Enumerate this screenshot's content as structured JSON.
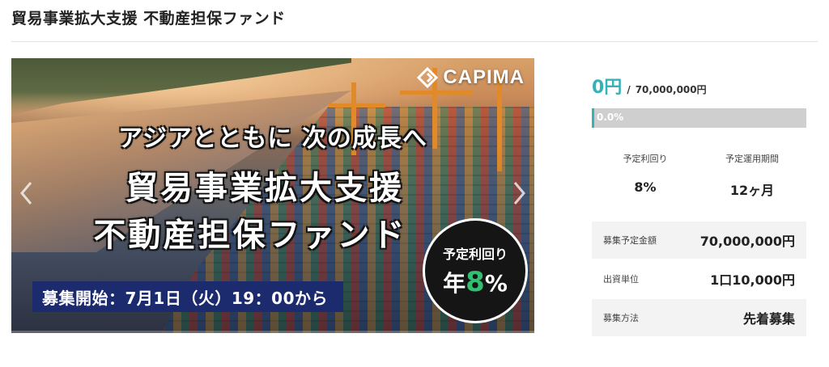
{
  "page": {
    "title": "貿易事業拡大支援 不動産担保ファンド"
  },
  "banner": {
    "logo_text": "CAPIMA",
    "headline_line1": "アジアとともに 次の成長へ",
    "headline_line2": "貿易事業拡大支援",
    "headline_line3": "不動産担保ファンド",
    "recruit_text": "募集開始：7月1日（火）19：00から",
    "badge_label": "予定利回り",
    "badge_prefix": "年",
    "badge_number": "8",
    "badge_percent": "%"
  },
  "funding": {
    "raised": "0円",
    "separator": "/",
    "target": "70,000,000円",
    "progress_text": "0.0%",
    "progress_fraction": 0.0
  },
  "stats": [
    {
      "label": "予定利回り",
      "value": "8%"
    },
    {
      "label": "予定運用期間",
      "value": "12ヶ月"
    }
  ],
  "details": [
    {
      "label": "募集予定金額",
      "value": "70,000,000円"
    },
    {
      "label": "出資単位",
      "value": "1口10,000円"
    },
    {
      "label": "募集方法",
      "value": "先着募集"
    }
  ],
  "colors": {
    "accent": "#35b2b8",
    "recruit_bar": "#1c2a6e",
    "badge_highlight": "#32c070"
  }
}
